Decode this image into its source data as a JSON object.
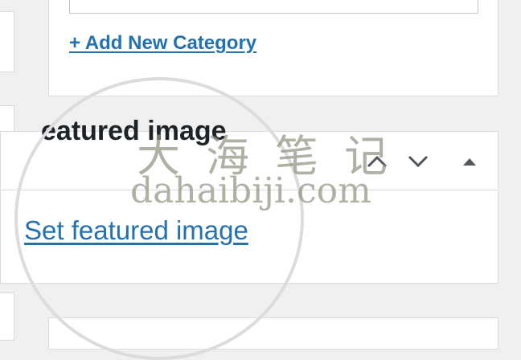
{
  "categories": {
    "add_new_label": "+ Add New Category"
  },
  "featured_image": {
    "title": "eatured image",
    "set_link": "Set featured image"
  },
  "panel_controls": {
    "move_up_icon": "chevron-up-icon",
    "move_down_icon": "chevron-down-icon",
    "toggle_icon": "triangle-up-icon"
  },
  "watermark": {
    "chinese": "大海笔记",
    "domain": "dahaibiji.com"
  },
  "colors": {
    "link": "#2271b1",
    "title": "#1d2327",
    "border": "#dcdcde",
    "background": "#f0f0f1",
    "icon": "#50575e"
  }
}
